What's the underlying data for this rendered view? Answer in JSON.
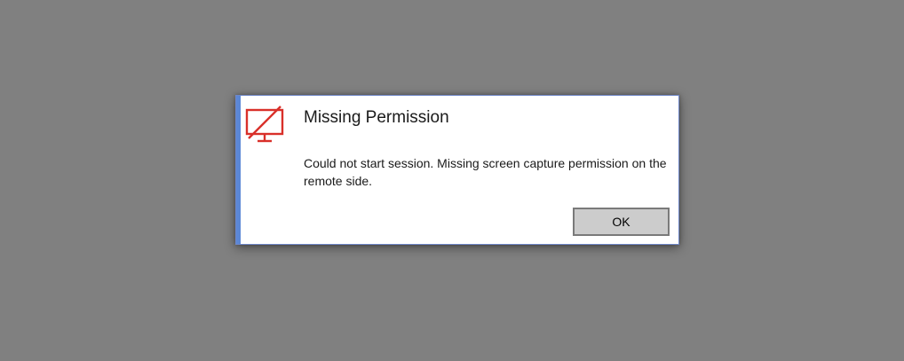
{
  "dialog": {
    "title": "Missing Permission",
    "message": "Could not start session. Missing screen capture permission on the remote side.",
    "ok_label": "OK",
    "icon": "monitor-disabled-icon"
  },
  "colors": {
    "backdrop": "#808080",
    "accent": "#5b87d6",
    "icon_red": "#d9302a",
    "button_bg": "#cccccc"
  }
}
